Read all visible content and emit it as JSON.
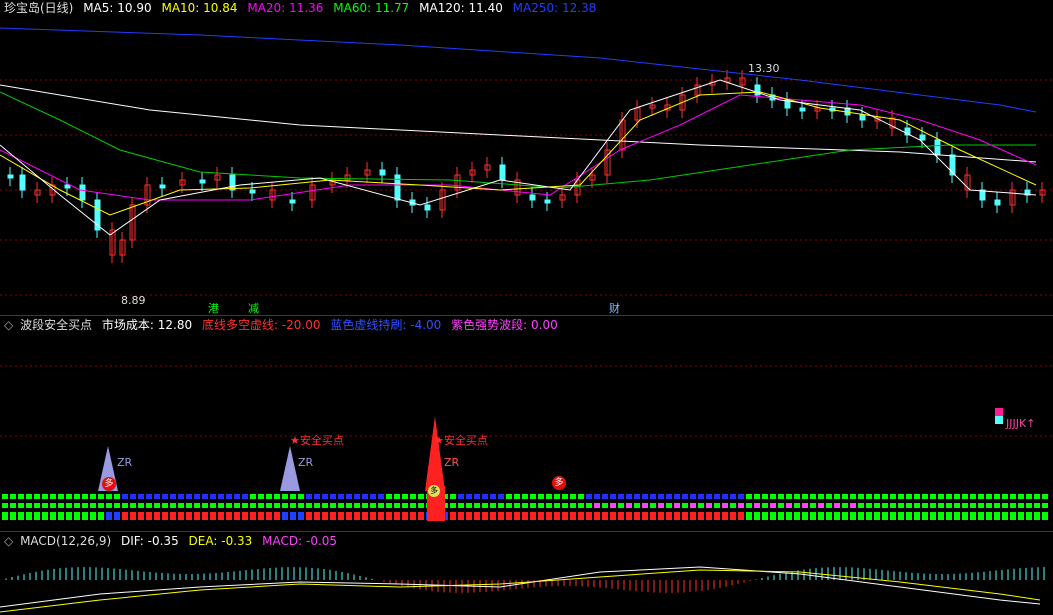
{
  "main": {
    "title": "珍宝岛(日线)",
    "ma": [
      {
        "label": "MA5:",
        "value": "10.90",
        "color": "#ffffff"
      },
      {
        "label": "MA10:",
        "value": "10.84",
        "color": "#ffff00"
      },
      {
        "label": "MA20:",
        "value": "11.36",
        "color": "#ff00ff"
      },
      {
        "label": "MA60:",
        "value": "11.77",
        "color": "#00ff00"
      },
      {
        "label": "MA120:",
        "value": "11.40",
        "color": "#ffffff"
      },
      {
        "label": "MA250:",
        "value": "12.38",
        "color": "#1f3fff"
      }
    ],
    "high_label": "13.30",
    "low_label": "8.89",
    "markers": [
      {
        "text": "港",
        "color": "#00ff00"
      },
      {
        "text": "减",
        "color": "#00ff00"
      },
      {
        "text": "财",
        "color": "#80c0ff"
      }
    ]
  },
  "indicator": {
    "name": "波段安全买点",
    "items": [
      {
        "label": "市场成本:",
        "value": "12.80",
        "color": "#ffffff"
      },
      {
        "label": "底线多空虚线:",
        "value": "-20.00",
        "color": "#ff3030"
      },
      {
        "label": "蓝色虚线持刷:",
        "value": "-4.00",
        "color": "#3050ff"
      },
      {
        "label": "紫色强势波段:",
        "value": "0.00",
        "color": "#ff40ff"
      }
    ],
    "signals": [
      {
        "text": "ZR"
      },
      {
        "text": "安全买点"
      },
      {
        "text": "安全买点"
      },
      {
        "text": "ZR"
      },
      {
        "text": "ZR"
      }
    ],
    "badge_text": "多",
    "right_text": "JJJJK↑"
  },
  "macd": {
    "name": "MACD(12,26,9)",
    "items": [
      {
        "label": "DIF:",
        "value": "-0.35",
        "color": "#ffffff"
      },
      {
        "label": "DEA:",
        "value": "-0.33",
        "color": "#ffff00"
      },
      {
        "label": "MACD:",
        "value": "-0.05",
        "color": "#ff40ff"
      }
    ]
  },
  "colors": {
    "up": "#ff3030",
    "down": "#54ffff",
    "grid": "#8b0000"
  }
}
